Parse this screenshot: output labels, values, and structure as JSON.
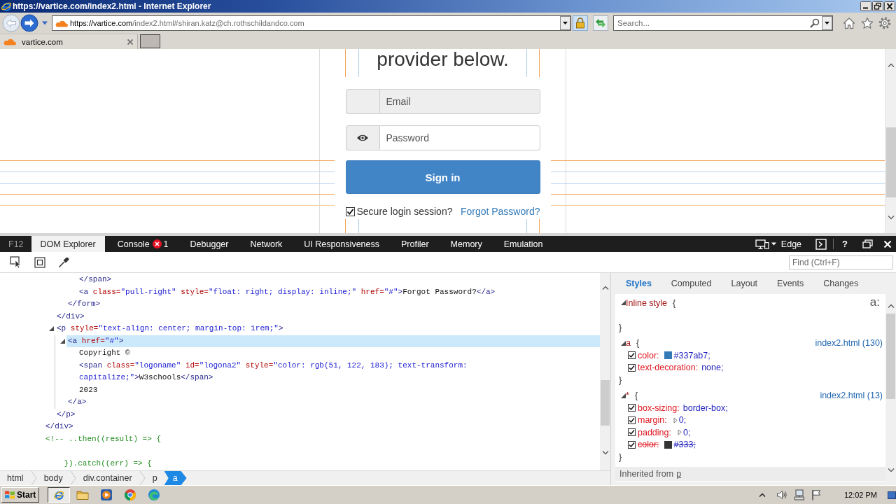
{
  "window": {
    "title": "https://vartice.com/index2.html - Internet Explorer"
  },
  "address_bar": {
    "host": "https://vartice.com",
    "path": "/index2.html#shiran.katz@ch.rothschildandco.com"
  },
  "search": {
    "placeholder": "Search..."
  },
  "tabs": [
    {
      "label": "vartice.com",
      "selected": true
    }
  ],
  "page": {
    "heading": "provider below.",
    "fields": [
      {
        "kind": "email",
        "placeholder": "Email",
        "disabled": true
      },
      {
        "kind": "password",
        "placeholder": "Password",
        "disabled": false
      }
    ],
    "submit": "Sign in",
    "remember": {
      "label": "Secure login session?",
      "checked": true
    },
    "forgot_link": "Forgot Password?"
  },
  "devtools": {
    "shortcut": "F12",
    "tabs": [
      {
        "label": "DOM Explorer",
        "selected": true
      },
      {
        "label": "Console",
        "selected": false,
        "errors": "1"
      },
      {
        "label": "Debugger",
        "selected": false
      },
      {
        "label": "Network",
        "selected": false
      },
      {
        "label": "UI Responsiveness",
        "selected": false
      },
      {
        "label": "Profiler",
        "selected": false
      },
      {
        "label": "Memory",
        "selected": false
      },
      {
        "label": "Emulation",
        "selected": false
      }
    ],
    "mode": "Edge",
    "help": "?",
    "find": {
      "placeholder": "Find (Ctrl+F)"
    },
    "dom_tree": {
      "nodes": [
        {
          "kind": "element",
          "selected": false,
          "children": [
            {
              "kind": "element",
              "selected": false,
              "children": [
                {
                  "kind": "element",
                  "selected": false,
                  "children": [
                    {
                      "kind": "markup",
                      "selected": false,
                      "text": "</span>"
                    },
                    {
                      "kind": "markup",
                      "selected": false,
                      "text": "<a class=\"pull-right\" style=\"float: right; display: inline;\" href=\"#\">Forgot Password?</a>"
                    }
                  ],
                  "close": "</form>"
                }
              ],
              "close": "</div>"
            },
            {
              "kind": "element",
              "selected": false,
              "open": "<p style=\"text-align: center; margin-top: 1rem;\">",
              "expanded": true,
              "children": [
                {
                  "kind": "element",
                  "selected": true,
                  "open": "<a href=\"#\">",
                  "expanded": true,
                  "children": [
                    {
                      "kind": "text",
                      "selected": false,
                      "text": "Copyright ©"
                    },
                    {
                      "kind": "markup",
                      "selected": false,
                      "text": "<span class=\"logoname\" id=\"logona2\" style=\"color: rgb(51, 122, 183); text-transform: capitalize;\">W3schools</span>"
                    },
                    {
                      "kind": "text",
                      "selected": false,
                      "text": "2023"
                    }
                  ],
                  "close": "</a>"
                }
              ],
              "close": "</p>"
            }
          ],
          "close": "</div>"
        },
        {
          "kind": "comment",
          "selected": false,
          "text": "<!-- ..then((result) => {\n\n    }).catch((err) => {"
        }
      ]
    },
    "breadcrumbs": [
      {
        "label": "html",
        "selected": false
      },
      {
        "label": "body",
        "selected": false
      },
      {
        "label": "div.container",
        "selected": false
      },
      {
        "label": "p",
        "selected": false
      },
      {
        "label": "a",
        "selected": true
      }
    ],
    "styles": {
      "tabs": [
        {
          "label": "Styles",
          "selected": true
        },
        {
          "label": "Computed",
          "selected": false
        },
        {
          "label": "Layout",
          "selected": false
        },
        {
          "label": "Events",
          "selected": false
        },
        {
          "label": "Changes",
          "selected": false
        }
      ],
      "pseudo_toggle": "a:",
      "rules": [
        {
          "selector": "Inline style",
          "open": "{",
          "close": "}",
          "expanded": true
        },
        {
          "selector": "a",
          "open": "{",
          "close": "}",
          "expanded": true,
          "source": "index2.html (130)",
          "declarations": [
            {
              "checked": true,
              "property": "color:",
              "value": "#337ab7;",
              "color": "#337ab7",
              "expandable": false,
              "overridden": false
            },
            {
              "checked": true,
              "property": "text-decoration:",
              "value": "none;",
              "expandable": false,
              "overridden": false
            }
          ]
        },
        {
          "selector": "*",
          "open": "{",
          "close": "}",
          "expanded": true,
          "source": "index2.html (13)",
          "declarations": [
            {
              "checked": true,
              "property": "box-sizing:",
              "value": "border-box;",
              "expandable": false,
              "overridden": false
            },
            {
              "checked": true,
              "property": "margin:",
              "value": "0;",
              "expandable": true,
              "overridden": false
            },
            {
              "checked": true,
              "property": "padding:",
              "value": "0;",
              "expandable": true,
              "overridden": false
            },
            {
              "checked": true,
              "property": "color:",
              "value": "#333;",
              "color": "#333333",
              "expandable": false,
              "overridden": true
            }
          ]
        }
      ],
      "inherited": {
        "label": "Inherited from",
        "element": "p"
      }
    }
  },
  "taskbar": {
    "start": "Start",
    "apps": [
      {
        "kind": "e-logo",
        "selected": true
      },
      {
        "kind": "folder",
        "selected": false
      },
      {
        "kind": "player",
        "selected": false
      },
      {
        "kind": "ring-logo",
        "selected": false
      },
      {
        "kind": "wave-logo",
        "selected": false
      }
    ],
    "clock": "12:02 PM"
  }
}
